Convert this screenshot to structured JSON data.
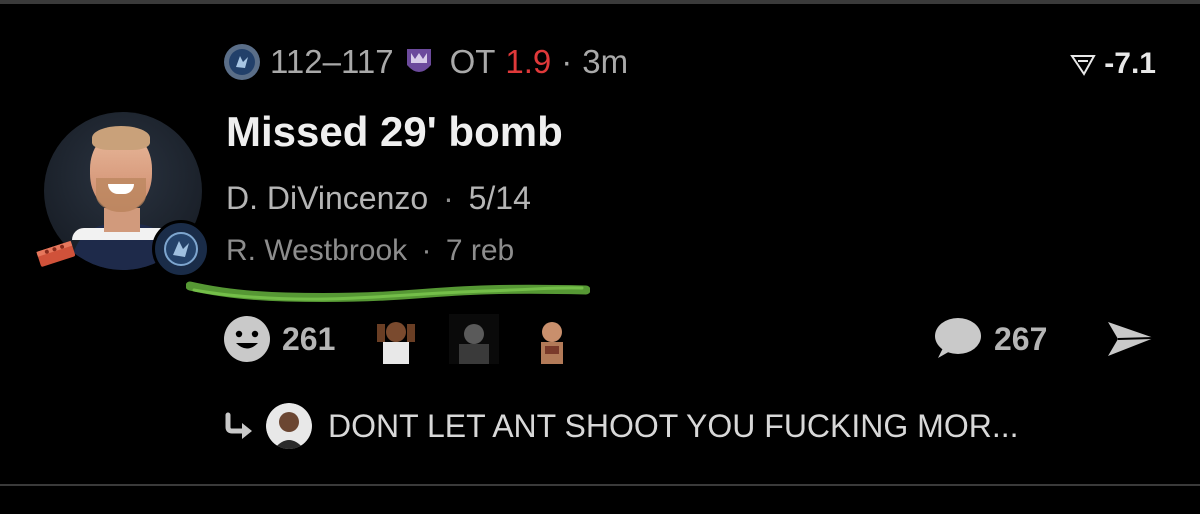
{
  "game": {
    "home_score_line": "112–117",
    "period": "OT",
    "clock": "1.9",
    "separator": "·",
    "time_ago": "3m",
    "spread": "-7.1",
    "spread_icon": "filter-icon"
  },
  "play": {
    "headline": "Missed 29' bomb",
    "shooter": "D. DiVincenzo",
    "shooter_stat": "5/14",
    "secondary": "R. Westbrook",
    "secondary_stat": "7 reb"
  },
  "reactions": {
    "emoji_icon": "smiley-icon",
    "count": "261",
    "thumbnails": [
      "reaction-face-1",
      "reaction-face-2",
      "reaction-face-3"
    ]
  },
  "comments": {
    "count": "267"
  },
  "reply": {
    "text": "DONT LET ANT SHOOT YOU FUCKING MOR..."
  },
  "colors": {
    "background": "#000000",
    "text_primary": "#efefef",
    "text_secondary": "#b5b5b5",
    "text_muted": "#8d8d8d",
    "clock_red": "#e0393a",
    "squiggle_green": "#5fa83a"
  }
}
